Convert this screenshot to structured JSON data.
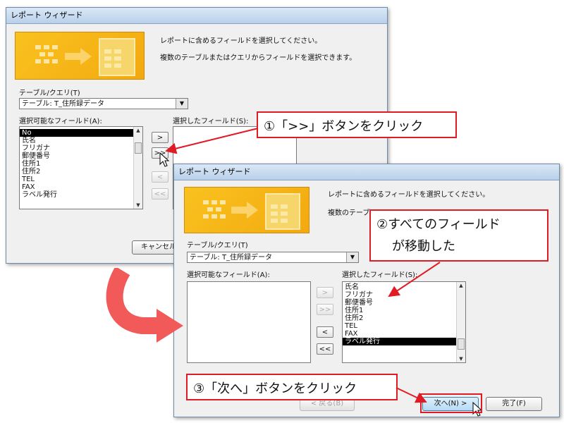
{
  "dialog1": {
    "title": "レポート ウィザード",
    "instruction": "レポートに含めるフィールドを選択してください。",
    "sub_instruction": "複数のテーブルまたはクエリからフィールドを選択できます。",
    "table_label": "テーブル/クエリ(T)",
    "table_value": "テーブル: T_住所録データ",
    "available_label": "選択可能なフィールド(A):",
    "selected_label": "選択したフィールド(S):",
    "available_fields": [
      "No",
      "氏名",
      "フリガナ",
      "郵便番号",
      "住所1",
      "住所2",
      "TEL",
      "FAX",
      "ラベル発行"
    ],
    "move_buttons": {
      "add_one": ">",
      "add_all": ">>",
      "remove_one": "<",
      "remove_all": "<<"
    },
    "cancel_label": "キャンセル"
  },
  "dialog2": {
    "title": "レポート ウィザード",
    "instruction": "レポートに含めるフィールドを選択してください。",
    "sub_instruction": "複数のテーブ",
    "table_label": "テーブル/クエリ(T)",
    "table_value": "テーブル: T_住所録データ",
    "available_label": "選択可能なフィールド(A):",
    "selected_label": "選択したフィールド(S):",
    "selected_fields": [
      "氏名",
      "フリガナ",
      "郵便番号",
      "住所1",
      "住所2",
      "TEL",
      "FAX",
      "ラベル発行"
    ],
    "move_buttons": {
      "add_one": ">",
      "add_all": ">>",
      "remove_one": "<",
      "remove_all": "<<"
    },
    "back_label": "< 戻る(B)",
    "next_label": "次へ(N) >",
    "finish_label": "完了(F)"
  },
  "callouts": {
    "step1": "①「>>」ボタンをクリック",
    "step2_line1": "②すべてのフィールド",
    "step2_line2": "が移動した",
    "step3": "③「次へ」ボタンをクリック"
  },
  "colors": {
    "accent_red": "#e01b24",
    "transition_arrow": "#f25a5a",
    "selection": "#000000"
  }
}
